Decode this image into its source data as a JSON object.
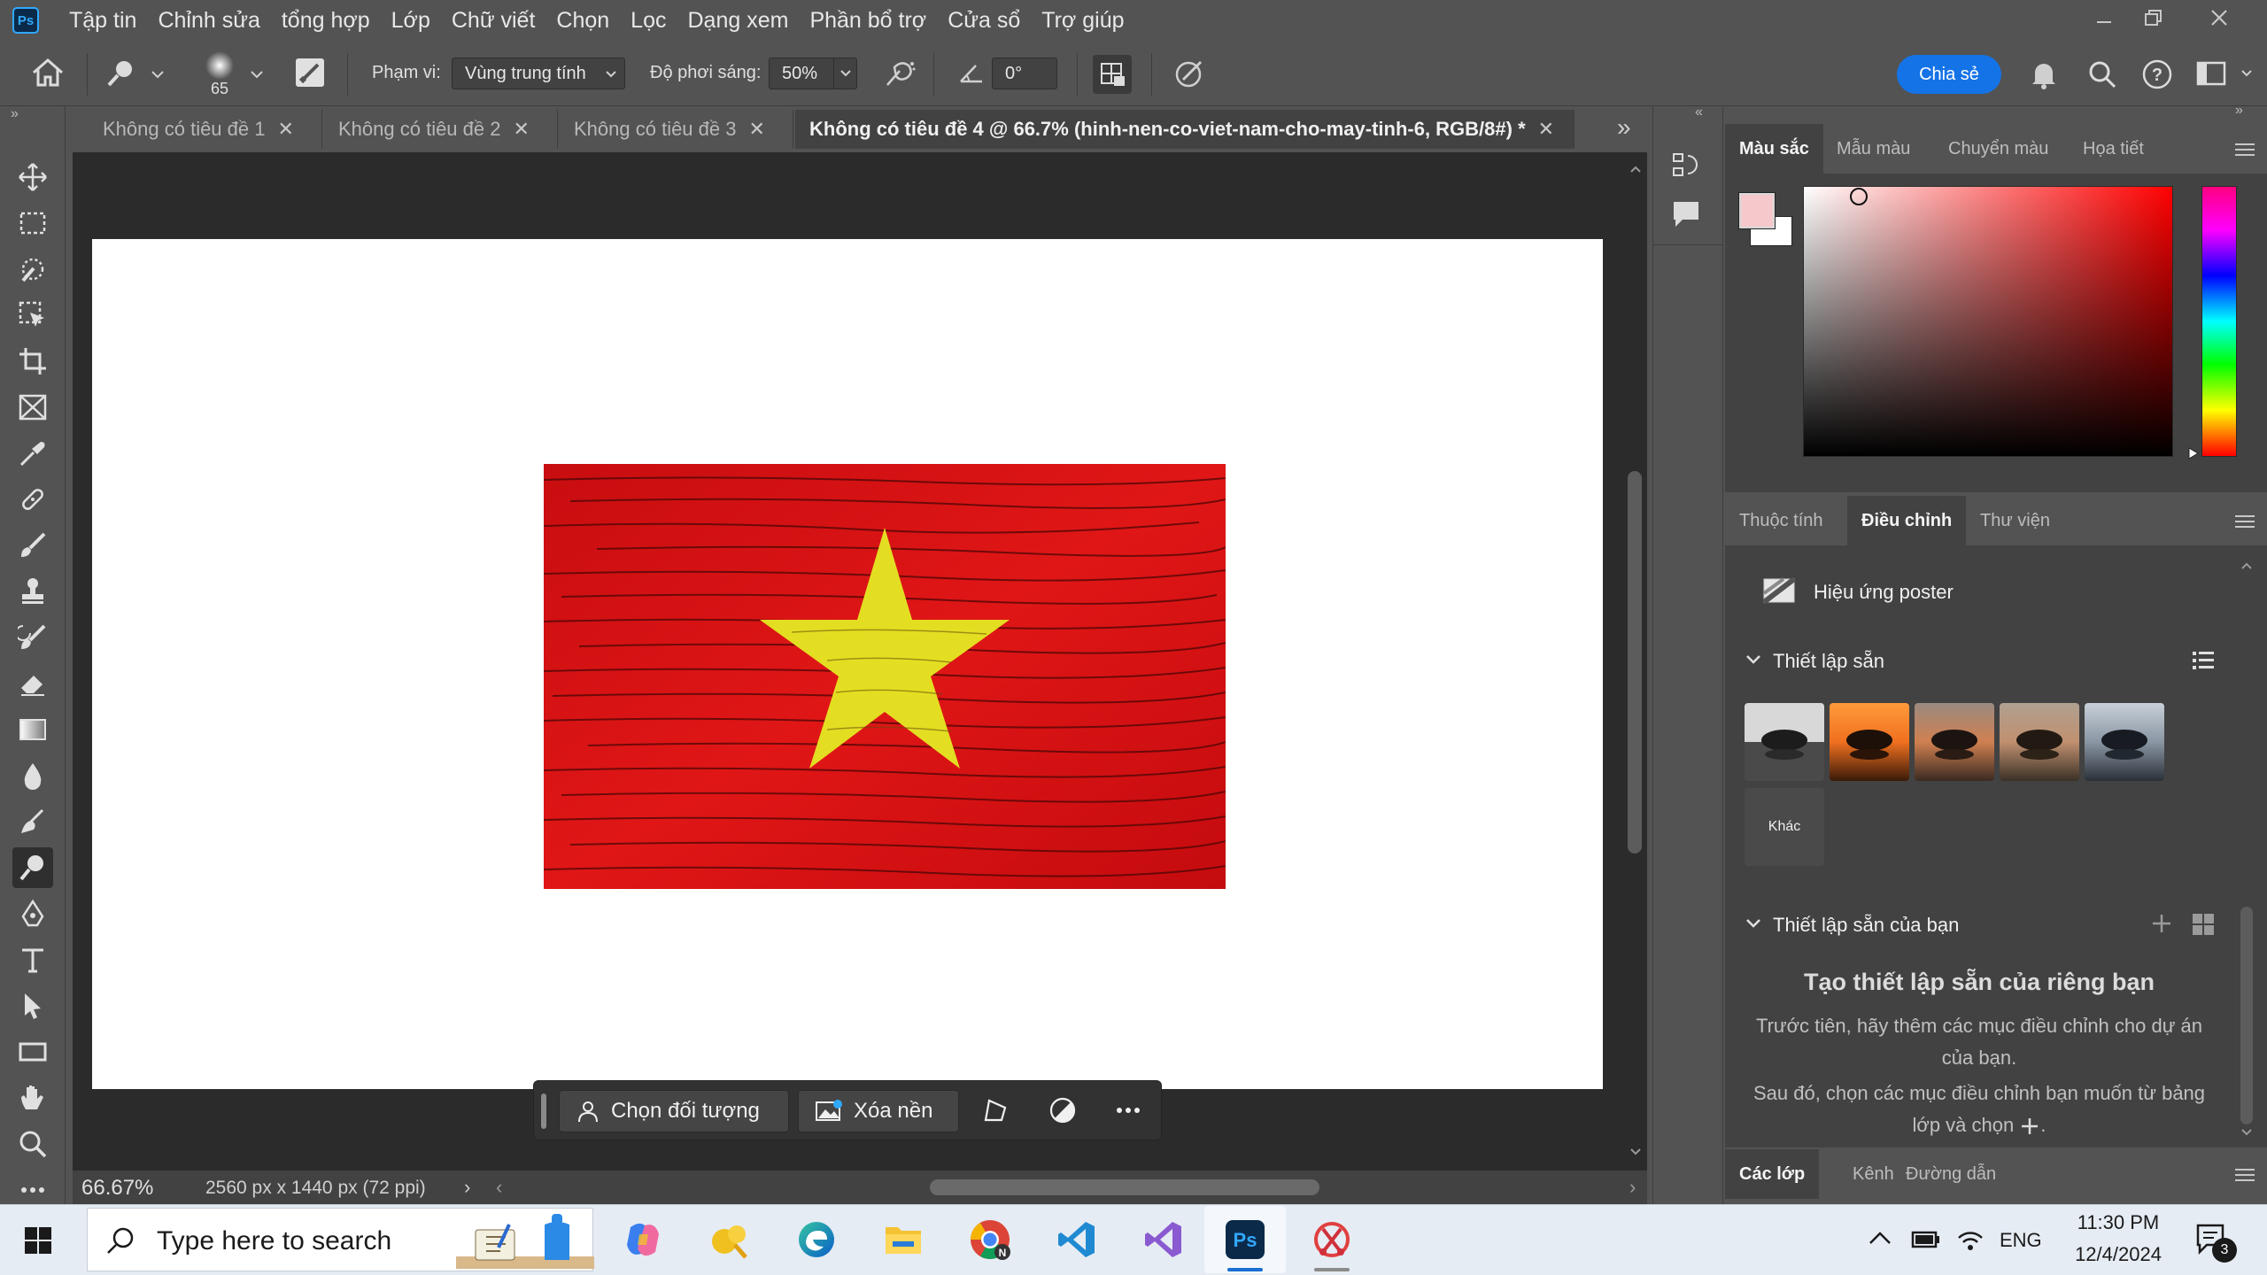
{
  "menu": [
    "Tập tin",
    "Chỉnh sửa",
    "tổng hợp",
    "Lớp",
    "Chữ viết",
    "Chọn",
    "Lọc",
    "Dạng xem",
    "Phần bổ trợ",
    "Cửa sổ",
    "Trợ giúp"
  ],
  "app_logo": "Ps",
  "options": {
    "brush_size": "65",
    "range_label": "Phạm vi:",
    "range_value": "Vùng trung tính",
    "exposure_label": "Độ phơi sáng:",
    "exposure_value": "50%",
    "angle_value": "0°",
    "share_label": "Chia sẻ"
  },
  "tabs": [
    "Không có tiêu đề 1",
    "Không có tiêu đề 2",
    "Không có tiêu đề 3",
    "Không có tiêu đề 4 @ 66.7% (hinh-nen-co-viet-nam-cho-may-tinh-6, RGB/8#) *"
  ],
  "context_bar": {
    "select_subject": "Chọn đối tượng",
    "remove_bg": "Xóa nền"
  },
  "status": {
    "zoom": "66.67%",
    "dimensions": "2560 px x 1440 px (72 ppi)"
  },
  "color_panel": {
    "tabs": [
      "Màu sắc",
      "Mẫu màu",
      "Chuyển màu",
      "Họa tiết"
    ],
    "foreground_color": "#f5c9cc",
    "background_color": "#ffffff"
  },
  "adjust_panel": {
    "tabs": [
      "Thuộc tính",
      "Điều chỉnh",
      "Thư viện"
    ],
    "poster_effect": "Hiệu ứng poster",
    "presets_header": "Thiết lập sẵn",
    "more_label": "Khác",
    "my_presets_header": "Thiết lập sẵn của bạn",
    "create_title": "Tạo thiết lập sẵn của riêng bạn",
    "create_line1": "Trước tiên, hãy thêm các mục điều chỉnh cho dự án",
    "create_line2": "của bạn.",
    "create_line3": "Sau đó, chọn các mục điều chỉnh bạn muốn từ bảng",
    "create_line4": "lớp và chọn",
    "create_line4_end": "."
  },
  "layers_panel": {
    "tabs": [
      "Các lớp",
      "Kênh",
      "Đường dẫn"
    ]
  },
  "taskbar": {
    "search_placeholder": "Type here to search",
    "language": "ENG",
    "time": "11:30 PM",
    "date": "12/4/2024",
    "notifications": "3"
  },
  "colors": {
    "accent": "#1473e6",
    "flag_red": "#d81414",
    "flag_star": "#e6e01e"
  }
}
